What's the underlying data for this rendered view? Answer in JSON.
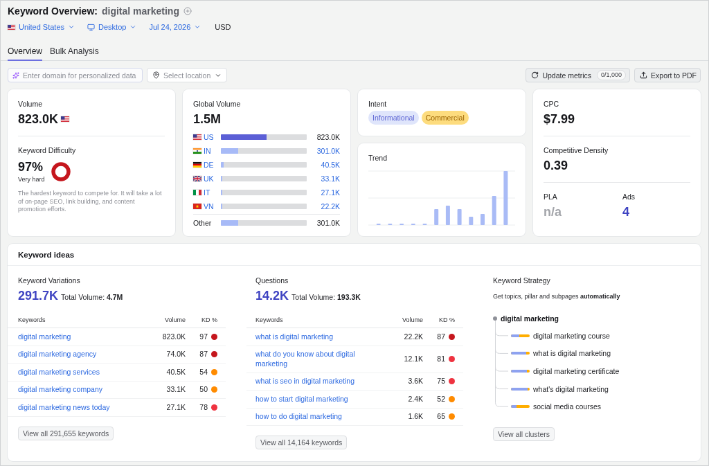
{
  "header": {
    "title": "Keyword Overview:",
    "keyword": "digital marketing"
  },
  "filters": [
    {
      "kind": "database",
      "label": "United States"
    },
    {
      "kind": "device",
      "label": "Desktop"
    },
    {
      "kind": "date",
      "label": "Jul 24, 2026"
    },
    {
      "kind": "currency",
      "label": "USD"
    }
  ],
  "tabs": [
    {
      "label": "Overview",
      "selected": true
    },
    {
      "label": "Bulk Analysis",
      "selected": false
    }
  ],
  "toolbar": {
    "domain_field": {
      "placeholder": "Enter domain for personalized data"
    },
    "location_select": {
      "placeholder": "Select location"
    },
    "update_button": {
      "label": "Update metrics",
      "counter": "0/1,000"
    },
    "export_button": {
      "label": "Export to PDF"
    }
  },
  "volume": {
    "label": "Volume",
    "value": "823.0K"
  },
  "keyword_difficulty": {
    "label": "Keyword Difficulty",
    "value": "97%",
    "rating": "Very hard",
    "description": "The hardest keyword to compete for. It will take a lot of on-page SEO, link building, and content promotion efforts."
  },
  "global_volume": {
    "label": "Global Volume",
    "value": "1.5M",
    "countries": [
      {
        "code": "US",
        "value": "823.0K",
        "level": 0.53,
        "current": true
      },
      {
        "code": "IN",
        "value": "301.0K",
        "level": 0.2,
        "current": false
      },
      {
        "code": "DE",
        "value": "40.5K",
        "level": 0.03,
        "current": false
      },
      {
        "code": "UK",
        "value": "33.1K",
        "level": 0.02,
        "current": false
      },
      {
        "code": "IT",
        "value": "27.1K",
        "level": 0.02,
        "current": false
      },
      {
        "code": "VN",
        "value": "22.2K",
        "level": 0.02,
        "current": false
      }
    ],
    "other": {
      "label": "Other",
      "value": "301.0K",
      "level": 0.2
    }
  },
  "intent": {
    "label": "Intent",
    "tags": [
      {
        "label": "Informational",
        "kind": "informational"
      },
      {
        "label": "Commercial",
        "kind": "commercial"
      }
    ]
  },
  "trend": {
    "label": "Trend"
  },
  "cpc": {
    "label": "CPC",
    "value": "$7.99"
  },
  "competitive_density": {
    "label": "Competitive Density",
    "value": "0.39"
  },
  "ad_metrics": [
    {
      "label": "PLA",
      "value": "n/a",
      "disabled": true
    },
    {
      "label": "Ads",
      "value": "4",
      "disabled": false
    }
  ],
  "keyword_ideas": {
    "title": "Keyword ideas",
    "sections": [
      {
        "kind": "table",
        "label": "Keyword Variations",
        "count": "291.7K",
        "total": "Total Volume: **4.7M**",
        "columns": [
          "Keywords",
          "Volume",
          "KD %"
        ],
        "rows": [
          {
            "keyword": "digital marketing",
            "volume": "823.0K",
            "kd": "97",
            "color": "#c5161d"
          },
          {
            "keyword": "digital marketing agency",
            "volume": "74.0K",
            "kd": "87",
            "color": "#c5161d"
          },
          {
            "keyword": "digital marketing services",
            "volume": "40.5K",
            "kd": "54",
            "color": "#ff8b00"
          },
          {
            "keyword": "digital marketing company",
            "volume": "33.1K",
            "kd": "50",
            "color": "#ff8b00"
          },
          {
            "keyword": "digital marketing news today",
            "volume": "27.1K",
            "kd": "78",
            "color": "#ef3340"
          }
        ],
        "button": "View all 291,655 keywords"
      },
      {
        "kind": "table",
        "label": "Questions",
        "count": "14.2K",
        "total": "Total Volume: **193.3K**",
        "columns": [
          "Keywords",
          "Volume",
          "KD %"
        ],
        "rows": [
          {
            "keyword": "what is digital marketing",
            "volume": "22.2K",
            "kd": "87",
            "color": "#c5161d"
          },
          {
            "keyword": "what do you know about digital marketing",
            "volume": "12.1K",
            "kd": "81",
            "color": "#ef3340"
          },
          {
            "keyword": "what is seo in digital marketing",
            "volume": "3.6K",
            "kd": "75",
            "color": "#ef3340"
          },
          {
            "keyword": "how to start digital marketing",
            "volume": "2.4K",
            "kd": "52",
            "color": "#ff8b00"
          },
          {
            "keyword": "how to do digital marketing",
            "volume": "1.6K",
            "kd": "65",
            "color": "#ff8b00"
          }
        ],
        "button": "View all 14,164 keywords"
      },
      {
        "kind": "tree",
        "label": "Keyword Strategy",
        "description": "Get topics, pillar and subpages **automatically**",
        "tree": {
          "label": "digital marketing",
          "children": [
            {
              "label": "digital marketing course",
              "level": 0.43
            },
            {
              "label": "what is digital marketing",
              "level": 0.82
            },
            {
              "label": "digital marketing certificate",
              "level": 0.85
            },
            {
              "label": "what's digital marketing",
              "level": 0.88
            },
            {
              "label": "social media courses",
              "level": 0.28
            }
          ]
        },
        "button": "View all clusters"
      }
    ]
  }
}
